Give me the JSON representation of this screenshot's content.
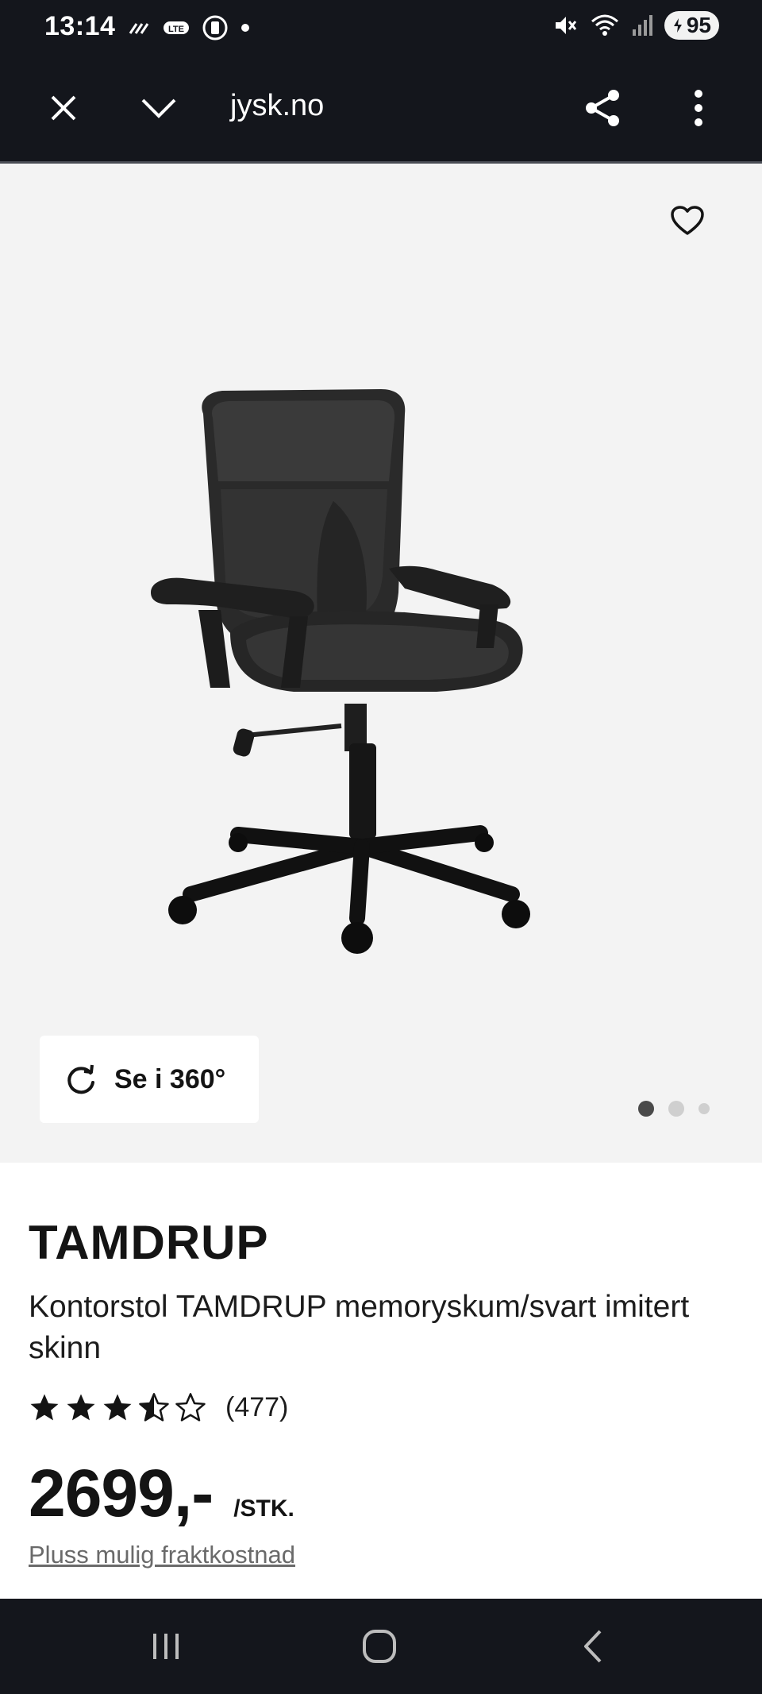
{
  "status_bar": {
    "time": "13:14",
    "battery": "95",
    "icons": [
      "signal-lines-icon",
      "data-badge-icon",
      "recording-icon",
      "notification-dot-icon",
      "mute-icon",
      "wifi-icon",
      "cell-signal-icon",
      "battery-icon"
    ]
  },
  "browser": {
    "url": "jysk.no",
    "close_icon": "close-icon",
    "collapse_icon": "chevron-down-icon",
    "share_icon": "share-icon",
    "menu_icon": "more-vertical-icon"
  },
  "gallery": {
    "view360_label": "Se i 360°",
    "slide_count": 3,
    "active_slide": 1,
    "background": "#f3f3f3"
  },
  "product": {
    "brand": "TAMDRUP",
    "description": "Kontorstol TAMDRUP memoryskum/svart imitert skinn",
    "rating_stars": 3.5,
    "rating_max": 5,
    "review_count": "(477)",
    "price": "2699,-",
    "unit": "/STK.",
    "shipping_link": "Pluss mulig fraktkostnad"
  },
  "colors": {
    "dark_bar": "#14161c",
    "text": "#141414",
    "muted": "#6a6a6a"
  }
}
